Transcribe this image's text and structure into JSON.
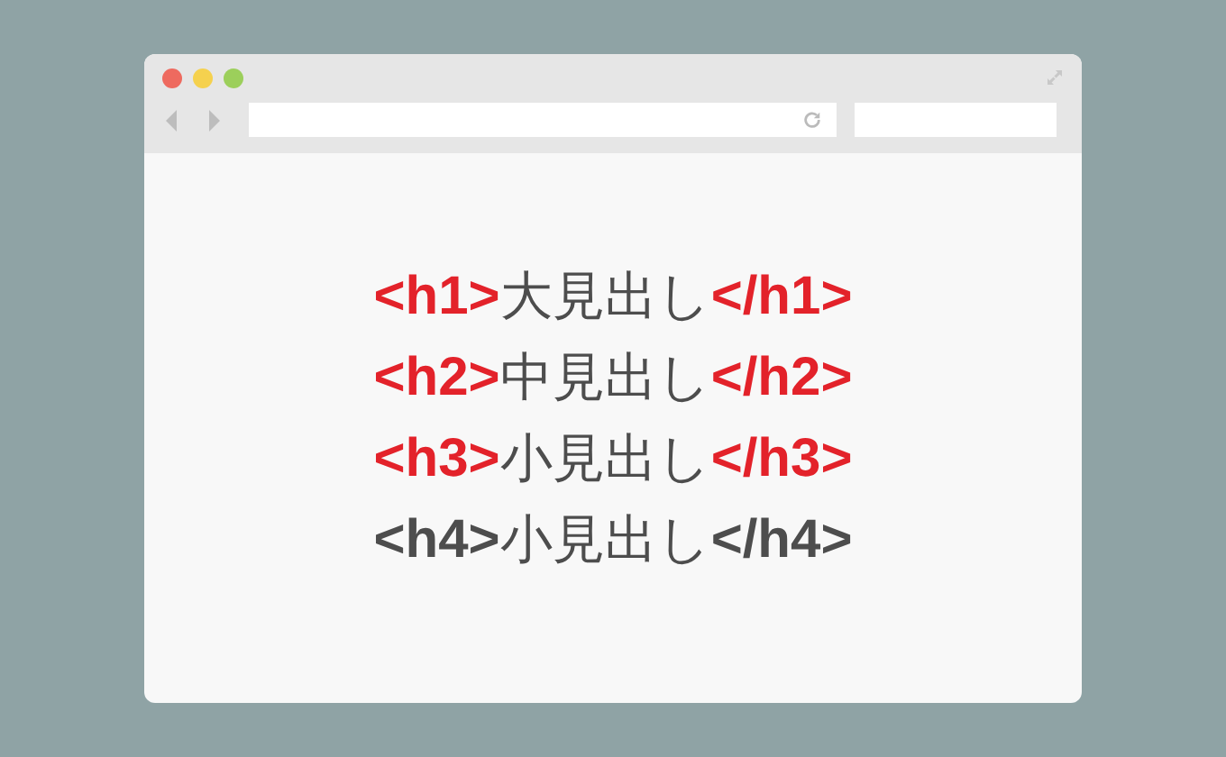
{
  "lines": [
    {
      "tag_open": "<h1>",
      "text": "大見出し",
      "tag_close": "</h1>",
      "highlighted": true
    },
    {
      "tag_open": "<h2>",
      "text": "中見出し",
      "tag_close": "</h2>",
      "highlighted": true
    },
    {
      "tag_open": "<h3>",
      "text": "小見出し",
      "tag_close": "</h3>",
      "highlighted": true
    },
    {
      "tag_open": "<h4>",
      "text": "小見出し",
      "tag_close": "</h4>",
      "highlighted": false
    }
  ]
}
